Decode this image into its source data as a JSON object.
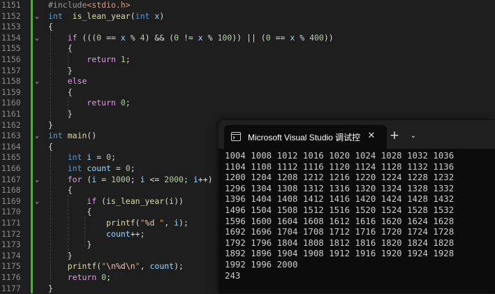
{
  "editor": {
    "lines": [
      {
        "n": "1151",
        "fold": ""
      },
      {
        "n": "1152",
        "fold": "⌄"
      },
      {
        "n": "1153",
        "fold": ""
      },
      {
        "n": "1154",
        "fold": "⌄"
      },
      {
        "n": "1155",
        "fold": ""
      },
      {
        "n": "1156",
        "fold": ""
      },
      {
        "n": "1157",
        "fold": ""
      },
      {
        "n": "1158",
        "fold": "⌄"
      },
      {
        "n": "1159",
        "fold": ""
      },
      {
        "n": "1160",
        "fold": ""
      },
      {
        "n": "1161",
        "fold": ""
      },
      {
        "n": "1162",
        "fold": ""
      },
      {
        "n": "1163",
        "fold": "⌄"
      },
      {
        "n": "1164",
        "fold": ""
      },
      {
        "n": "1165",
        "fold": ""
      },
      {
        "n": "1166",
        "fold": ""
      },
      {
        "n": "1167",
        "fold": "⌄"
      },
      {
        "n": "1168",
        "fold": ""
      },
      {
        "n": "1169",
        "fold": "⌄"
      },
      {
        "n": "1170",
        "fold": ""
      },
      {
        "n": "1171",
        "fold": ""
      },
      {
        "n": "1172",
        "fold": ""
      },
      {
        "n": "1173",
        "fold": ""
      },
      {
        "n": "1174",
        "fold": ""
      },
      {
        "n": "1175",
        "fold": ""
      },
      {
        "n": "1176",
        "fold": ""
      },
      {
        "n": "1177",
        "fold": ""
      }
    ],
    "code": [
      [
        [
          "pp",
          "#include"
        ],
        [
          "str",
          "<stdio.h>"
        ]
      ],
      [
        [
          "kw",
          "int"
        ],
        [
          "",
          "  "
        ],
        [
          "fn",
          "is_lean_year"
        ],
        [
          "",
          "("
        ],
        [
          "kw",
          "int"
        ],
        [
          "",
          " "
        ],
        [
          "par",
          "x"
        ],
        [
          "",
          ")"
        ]
      ],
      [
        [
          "",
          "{"
        ]
      ],
      [
        [
          "",
          "    "
        ],
        [
          "ctl",
          "if"
        ],
        [
          "",
          " ((("
        ],
        [
          "num",
          "0"
        ],
        [
          "",
          " == "
        ],
        [
          "par",
          "x"
        ],
        [
          "",
          " % "
        ],
        [
          "num",
          "4"
        ],
        [
          "",
          ") && ("
        ],
        [
          "num",
          "0"
        ],
        [
          "",
          " != "
        ],
        [
          "par",
          "x"
        ],
        [
          "",
          " % "
        ],
        [
          "num",
          "100"
        ],
        [
          "",
          ")) || ("
        ],
        [
          "num",
          "0"
        ],
        [
          "",
          " == "
        ],
        [
          "par",
          "x"
        ],
        [
          "",
          " % "
        ],
        [
          "num",
          "400"
        ],
        [
          "",
          "))"
        ]
      ],
      [
        [
          "",
          "    {"
        ]
      ],
      [
        [
          "",
          "        "
        ],
        [
          "ctl",
          "return"
        ],
        [
          "",
          " "
        ],
        [
          "num",
          "1"
        ],
        [
          "",
          ";"
        ]
      ],
      [
        [
          "",
          "    }"
        ]
      ],
      [
        [
          "",
          "    "
        ],
        [
          "ctl",
          "else"
        ]
      ],
      [
        [
          "",
          "    {"
        ]
      ],
      [
        [
          "",
          "        "
        ],
        [
          "ctl",
          "return"
        ],
        [
          "",
          " "
        ],
        [
          "num",
          "0"
        ],
        [
          "",
          ";"
        ]
      ],
      [
        [
          "",
          "    }"
        ]
      ],
      [
        [
          "",
          "}"
        ]
      ],
      [
        [
          "kw",
          "int"
        ],
        [
          "",
          " "
        ],
        [
          "fn",
          "main"
        ],
        [
          "",
          "()"
        ]
      ],
      [
        [
          "",
          "{"
        ]
      ],
      [
        [
          "",
          "    "
        ],
        [
          "kw",
          "int"
        ],
        [
          "",
          " "
        ],
        [
          "var",
          "i"
        ],
        [
          "",
          " = "
        ],
        [
          "num",
          "0"
        ],
        [
          "",
          ";"
        ]
      ],
      [
        [
          "",
          "    "
        ],
        [
          "kw",
          "int"
        ],
        [
          "",
          " "
        ],
        [
          "var",
          "count"
        ],
        [
          "",
          " = "
        ],
        [
          "num",
          "0"
        ],
        [
          "",
          ";"
        ]
      ],
      [
        [
          "",
          "    "
        ],
        [
          "ctl",
          "for"
        ],
        [
          "",
          " ("
        ],
        [
          "var",
          "i"
        ],
        [
          "",
          " = "
        ],
        [
          "num",
          "1000"
        ],
        [
          "",
          "; "
        ],
        [
          "var",
          "i"
        ],
        [
          "",
          " <= "
        ],
        [
          "num",
          "2000"
        ],
        [
          "",
          "; "
        ],
        [
          "var",
          "i"
        ],
        [
          "",
          "++)"
        ]
      ],
      [
        [
          "",
          "    {"
        ]
      ],
      [
        [
          "",
          "        "
        ],
        [
          "ctl",
          "if"
        ],
        [
          "",
          " ("
        ],
        [
          "fn",
          "is_lean_year"
        ],
        [
          "",
          "("
        ],
        [
          "var",
          "i"
        ],
        [
          "",
          "))"
        ]
      ],
      [
        [
          "",
          "        {"
        ]
      ],
      [
        [
          "",
          "            "
        ],
        [
          "fn",
          "printf"
        ],
        [
          "",
          "("
        ],
        [
          "str",
          "\""
        ],
        [
          "fmt",
          "%d"
        ],
        [
          "str",
          " \""
        ],
        [
          "",
          ", "
        ],
        [
          "var",
          "i"
        ],
        [
          "",
          ");"
        ]
      ],
      [
        [
          "",
          "            "
        ],
        [
          "var",
          "count"
        ],
        [
          "",
          "++;"
        ]
      ],
      [
        [
          "",
          "        }"
        ]
      ],
      [
        [
          "",
          "    }"
        ]
      ],
      [
        [
          "",
          "    "
        ],
        [
          "fn",
          "printf"
        ],
        [
          "",
          "("
        ],
        [
          "str",
          "\""
        ],
        [
          "fmt",
          "\\n%d\\n"
        ],
        [
          "str",
          "\""
        ],
        [
          "",
          ", "
        ],
        [
          "var",
          "count"
        ],
        [
          "",
          ");"
        ]
      ],
      [
        [
          "",
          "    "
        ],
        [
          "ctl",
          "return"
        ],
        [
          "",
          " "
        ],
        [
          "num",
          "0"
        ],
        [
          "",
          ";"
        ]
      ],
      [
        [
          "",
          "}"
        ]
      ]
    ]
  },
  "console": {
    "tab_title": "Microsoft Visual Studio 调试控",
    "tab_icon": "console-window-icon",
    "close_glyph": "✕",
    "new_tab_glyph": "+",
    "dropdown_glyph": "⌄",
    "background": "#0c0c0c",
    "output": [
      "1004 1008 1012 1016 1020 1024 1028 1032 1036",
      "1104 1108 1112 1116 1120 1124 1128 1132 1136",
      "1200 1204 1208 1212 1216 1220 1224 1228 1232",
      "1296 1304 1308 1312 1316 1320 1324 1328 1332",
      "1396 1404 1408 1412 1416 1420 1424 1428 1432",
      "1496 1504 1508 1512 1516 1520 1524 1528 1532",
      "1596 1600 1604 1608 1612 1616 1620 1624 1628",
      "1692 1696 1704 1708 1712 1716 1720 1724 1728",
      "1792 1796 1804 1808 1812 1816 1820 1824 1828",
      "1892 1896 1904 1908 1912 1916 1920 1924 1928",
      "1992 1996 2000",
      "243"
    ]
  },
  "colors": {
    "editor_bg": "#1e1e1e",
    "change_bar": "#57a64a",
    "keyword": "#569cd6",
    "control": "#d8a0df",
    "function": "#dcdcaa",
    "string": "#d69d85",
    "number": "#b5cea8"
  }
}
